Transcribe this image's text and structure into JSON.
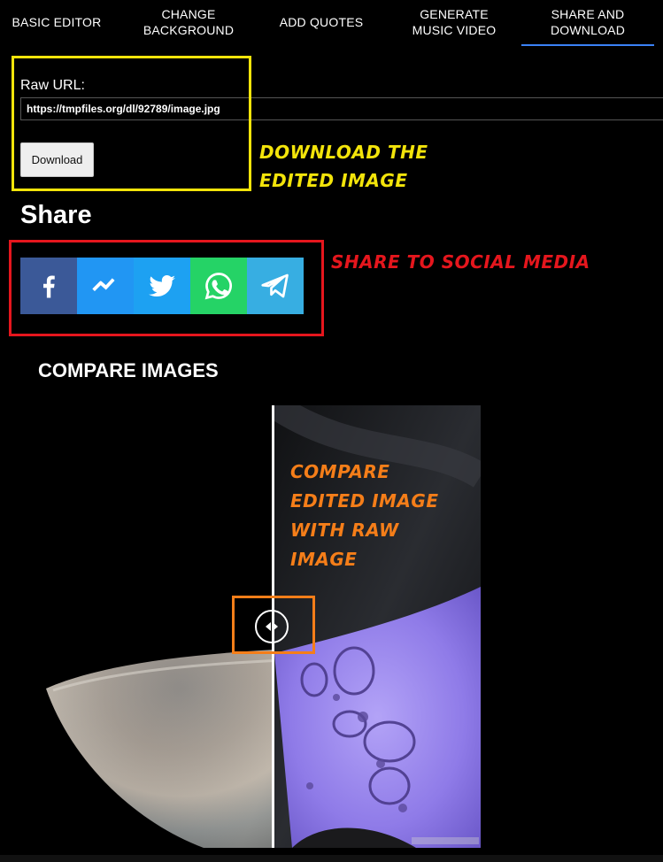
{
  "tabs": [
    {
      "label": "BASIC EDITOR",
      "active": false
    },
    {
      "label": "CHANGE BACKGROUND",
      "active": false
    },
    {
      "label": "ADD QUOTES",
      "active": false
    },
    {
      "label": "GENERATE MUSIC VIDEO",
      "active": false
    },
    {
      "label": "SHARE AND DOWNLOAD",
      "active": true
    }
  ],
  "download_section": {
    "raw_url_label": "Raw URL:",
    "raw_url_value": "https://tmpfiles.org/dl/92789/image.jpg",
    "download_button_label": "Download",
    "annotation": "DOWNLOAD THE EDITED IMAGE"
  },
  "share_section": {
    "title": "Share",
    "annotation": "SHARE TO SOCIAL MEDIA",
    "buttons": [
      {
        "icon": "facebook-icon",
        "color": "#3b5998"
      },
      {
        "icon": "messenger-icon",
        "color": "#2196f3"
      },
      {
        "icon": "twitter-icon",
        "color": "#1da1f2"
      },
      {
        "icon": "whatsapp-icon",
        "color": "#25d366"
      },
      {
        "icon": "telegram-icon",
        "color": "#37aee2"
      }
    ]
  },
  "compare_section": {
    "title": "COMPARE IMAGES",
    "annotation": "COMPARE EDITED IMAGE WITH RAW IMAGE",
    "slider_handle_icon": "left-right-arrows-icon"
  },
  "annotation_colors": {
    "download": "#f3e40a",
    "share": "#e5161d",
    "compare": "#f57e19"
  }
}
